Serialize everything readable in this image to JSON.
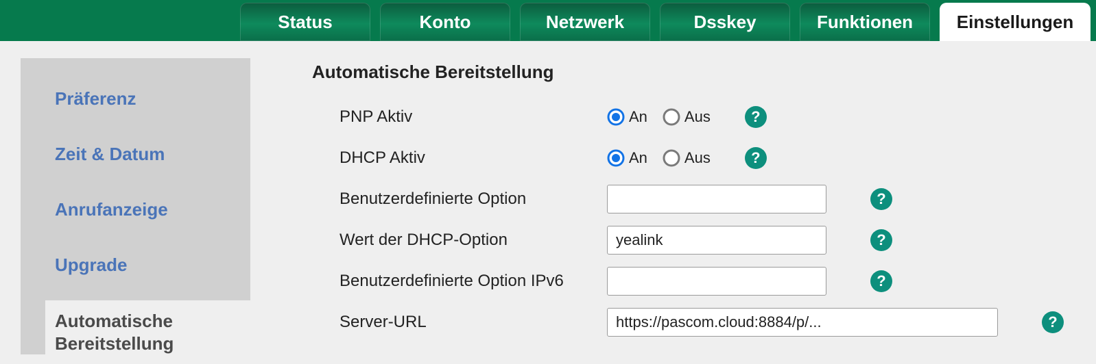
{
  "tabs": {
    "status": "Status",
    "konto": "Konto",
    "netzwerk": "Netzwerk",
    "dsskey": "Dsskey",
    "funktionen": "Funktionen",
    "einstellungen": "Einstellungen"
  },
  "sidebar": {
    "praeferenz": "Präferenz",
    "zeit_datum": "Zeit & Datum",
    "anrufanzeige": "Anrufanzeige",
    "upgrade": "Upgrade",
    "autoprov_l1": "Automatische",
    "autoprov_l2": "Bereitstellung"
  },
  "section": {
    "title": "Automatische Bereitstellung"
  },
  "labels": {
    "pnp_aktiv": "PNP Aktiv",
    "dhcp_aktiv": "DHCP Aktiv",
    "custom_option": "Benutzerdefinierte Option",
    "dhcp_value": "Wert der DHCP-Option",
    "custom_opt_ipv6": "Benutzerdefinierte Option IPv6",
    "server_url": "Server-URL"
  },
  "radio": {
    "an": "An",
    "aus": "Aus"
  },
  "values": {
    "custom_option": "",
    "dhcp_value": "yealink",
    "custom_opt_ipv6": "",
    "server_url": "https://pascom.cloud:8884/p/..."
  },
  "help_glyph": "?"
}
